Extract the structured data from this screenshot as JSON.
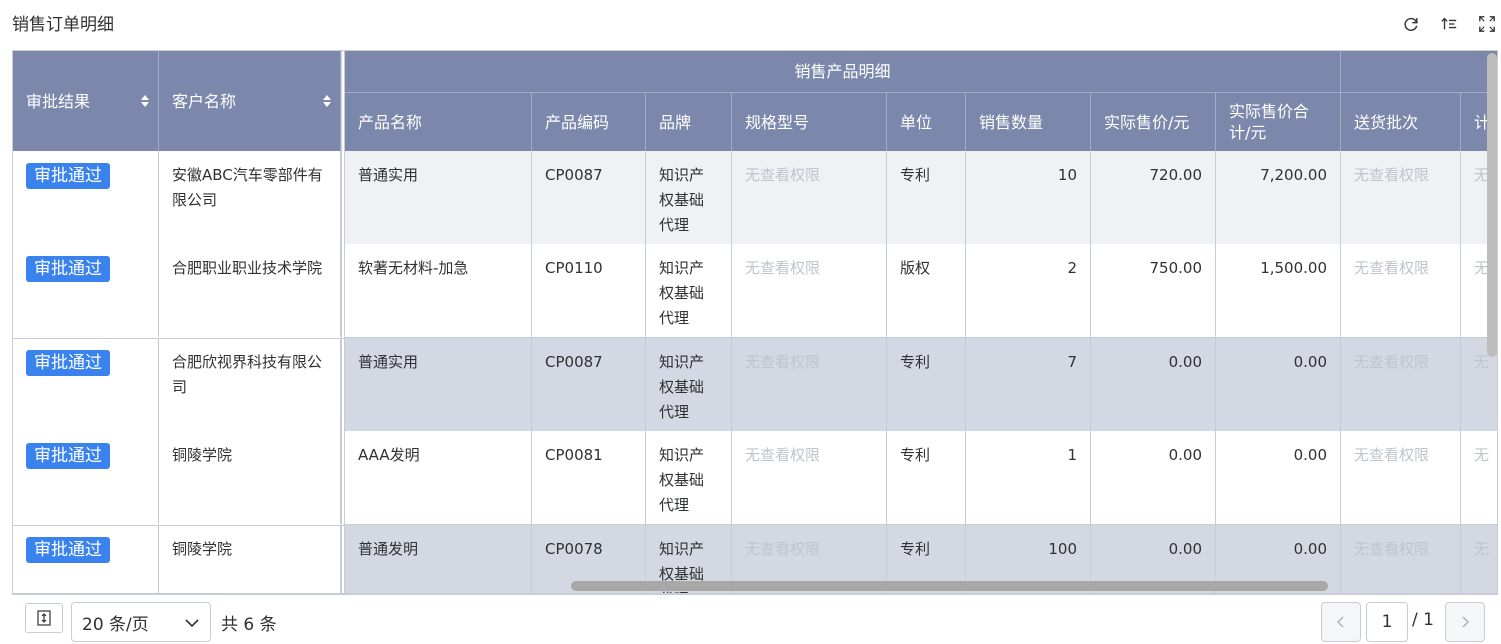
{
  "page": {
    "title": "销售订单明细"
  },
  "toolbar": {
    "refresh_icon": "refresh-icon",
    "sort_icon": "sort-list-icon",
    "fullscreen_icon": "fullscreen-icon"
  },
  "table": {
    "headers": {
      "approval": "审批结果",
      "customer": "客户名称",
      "group": "销售产品明细",
      "product_name": "产品名称",
      "product_code": "产品编码",
      "brand": "品牌",
      "spec": "规格型号",
      "unit": "单位",
      "qty": "销售数量",
      "price": "实际售价/元",
      "total": "实际售价合计/元",
      "batch": "送货批次",
      "partial": "计"
    },
    "orders": [
      {
        "status": "审批通过",
        "customer": "安徽ABC汽车零部件有限公司"
      },
      {
        "status": "审批通过",
        "customer": "合肥职业职业技术学院"
      },
      {
        "status": "审批通过",
        "customer": "合肥欣视界科技有限公司"
      },
      {
        "status": "审批通过",
        "customer": "铜陵学院"
      },
      {
        "status": "审批通过",
        "customer": "铜陵学院"
      }
    ],
    "rows": [
      {
        "product_name": "普通实用",
        "product_code": "CP0087",
        "brand": "知识产权基础代理",
        "spec": "无查看权限",
        "unit": "专利",
        "qty": "10",
        "price": "720.00",
        "total": "7,200.00",
        "batch": "无查看权限",
        "partial": "无"
      },
      {
        "product_name": "软著无材料-加急",
        "product_code": "CP0110",
        "brand": "知识产权基础代理",
        "spec": "无查看权限",
        "unit": "版权",
        "qty": "2",
        "price": "750.00",
        "total": "1,500.00",
        "batch": "无查看权限",
        "partial": "无"
      },
      {
        "product_name": "普通实用",
        "product_code": "CP0087",
        "brand": "知识产权基础代理",
        "spec": "无查看权限",
        "unit": "专利",
        "qty": "7",
        "price": "0.00",
        "total": "0.00",
        "batch": "无查看权限",
        "partial": "无"
      },
      {
        "product_name": "AAA发明",
        "product_code": "CP0081",
        "brand": "知识产权基础代理",
        "spec": "无查看权限",
        "unit": "专利",
        "qty": "1",
        "price": "0.00",
        "total": "0.00",
        "batch": "无查看权限",
        "partial": "无"
      },
      {
        "product_name": "普通发明",
        "product_code": "CP0078",
        "brand": "知识产权基础代理",
        "spec": "无查看权限",
        "unit": "专利",
        "qty": "100",
        "price": "0.00",
        "total": "0.00",
        "batch": "无查看权限",
        "partial": "无"
      }
    ]
  },
  "footer": {
    "page_size": "20 条/页",
    "total": "共 6 条",
    "current_page": "1",
    "page_count": "/ 1"
  }
}
